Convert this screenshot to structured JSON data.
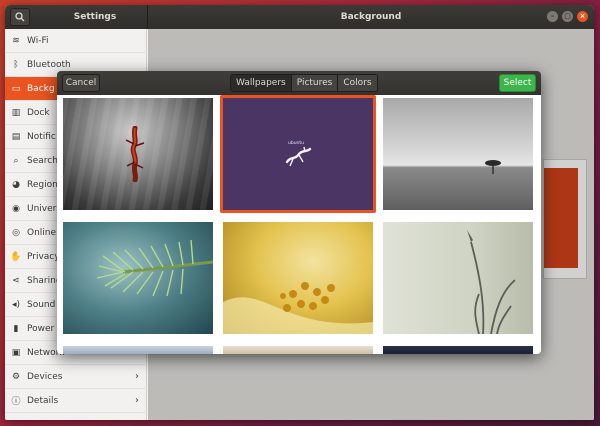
{
  "window": {
    "left_title": "Settings",
    "title": "Background",
    "controls": {
      "minimize": "–",
      "maximize": "□",
      "close": "×"
    }
  },
  "sidebar": {
    "items": [
      {
        "label": "Wi-Fi",
        "icon": "wifi-icon",
        "glyph": "≋"
      },
      {
        "label": "Bluetooth",
        "icon": "bluetooth-icon",
        "glyph": "ᛒ"
      },
      {
        "label": "Backg",
        "icon": "background-icon",
        "glyph": "▭",
        "active": true
      },
      {
        "label": "Dock",
        "icon": "dock-icon",
        "glyph": "▥"
      },
      {
        "label": "Notific",
        "icon": "notification-icon",
        "glyph": "▤"
      },
      {
        "label": "Search",
        "icon": "search-icon",
        "glyph": "⌕"
      },
      {
        "label": "Region",
        "icon": "region-icon",
        "glyph": "◕"
      },
      {
        "label": "Univers",
        "icon": "universal-access-icon",
        "glyph": "◉"
      },
      {
        "label": "Online",
        "icon": "online-accounts-icon",
        "glyph": "◎"
      },
      {
        "label": "Privacy",
        "icon": "privacy-icon",
        "glyph": "✋"
      },
      {
        "label": "Sharing",
        "icon": "sharing-icon",
        "glyph": "⋖"
      },
      {
        "label": "Sound",
        "icon": "sound-icon",
        "glyph": "◂)"
      },
      {
        "label": "Power",
        "icon": "power-icon",
        "glyph": "▮"
      },
      {
        "label": "Network",
        "icon": "network-icon",
        "glyph": "▣"
      },
      {
        "label": "Devices",
        "icon": "devices-icon",
        "glyph": "⚙",
        "chevron": "›"
      },
      {
        "label": "Details",
        "icon": "details-icon",
        "glyph": "ⓘ",
        "chevron": "›"
      }
    ]
  },
  "dialog": {
    "cancel_label": "Cancel",
    "select_label": "Select",
    "tabs": [
      {
        "label": "Wallpapers",
        "active": true
      },
      {
        "label": "Pictures",
        "active": false
      },
      {
        "label": "Colors",
        "active": false
      }
    ],
    "selected_index": 1,
    "wallpapers": [
      {
        "name": "wallpaper-gecko-grey"
      },
      {
        "name": "wallpaper-ubuntu-purple",
        "text": "ubuntu"
      },
      {
        "name": "wallpaper-lone-tree"
      },
      {
        "name": "wallpaper-pine-branch"
      },
      {
        "name": "wallpaper-yellow-flower"
      },
      {
        "name": "wallpaper-grass-stalks"
      },
      {
        "name": "wallpaper-sky"
      },
      {
        "name": "wallpaper-warm-light"
      },
      {
        "name": "wallpaper-dark-blue"
      }
    ]
  },
  "colors": {
    "accent": "#e95420",
    "select_green": "#3cb54a",
    "titlebar": "#3b3a36"
  }
}
